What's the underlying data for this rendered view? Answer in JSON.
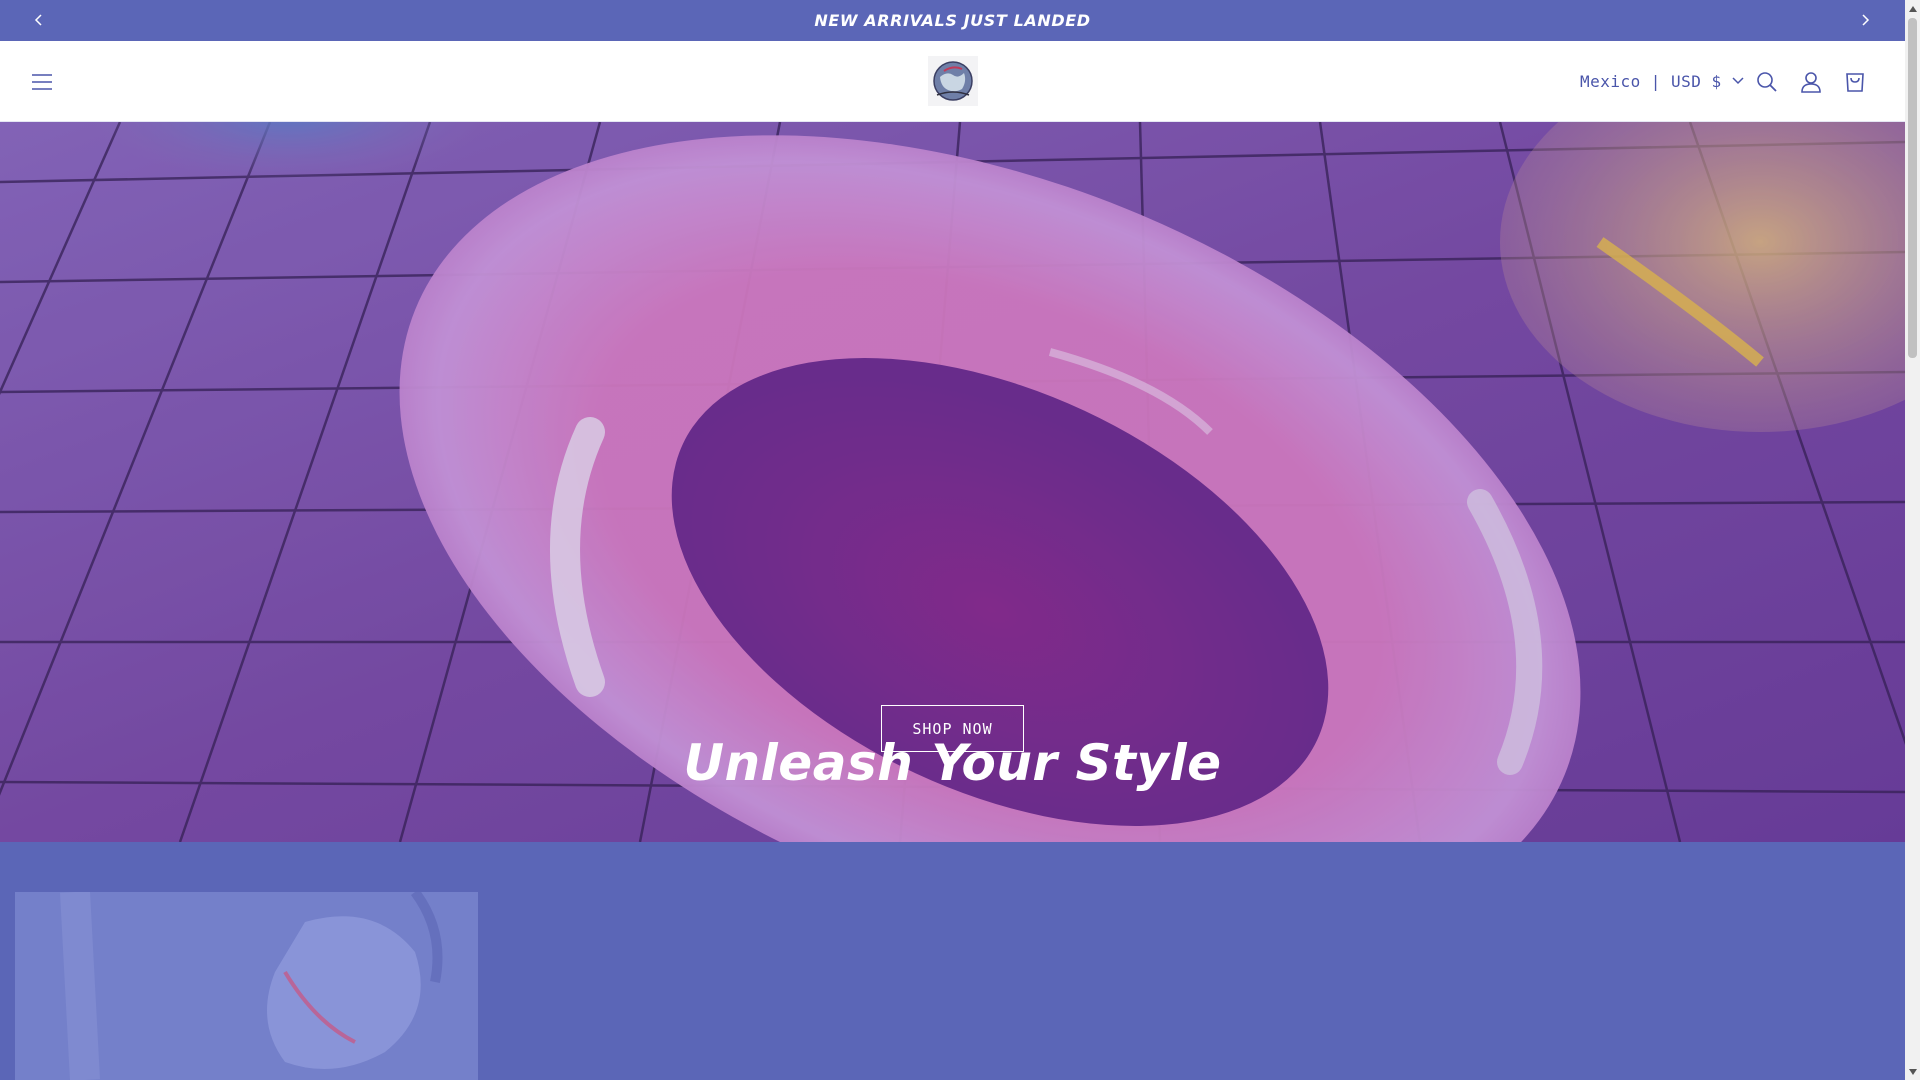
{
  "announcement": {
    "text": "NEW ARRIVALS JUST LANDED",
    "prev_icon": "chevron-left-icon",
    "next_icon": "chevron-right-icon"
  },
  "header": {
    "menu_icon": "hamburger-menu-icon",
    "logo_alt": "store logo",
    "locale": {
      "country": "Mexico",
      "separator": "|",
      "currency": "USD $"
    },
    "icons": [
      "search-icon",
      "account-icon",
      "cart-icon"
    ]
  },
  "hero": {
    "title": "Unleash Your Style",
    "cta_label": "SHOP NOW"
  },
  "colors": {
    "accent": "#5b66b7",
    "header_bg": "#ffffff",
    "locale_text": "#4a55aa",
    "hero_text": "#ffffff"
  }
}
